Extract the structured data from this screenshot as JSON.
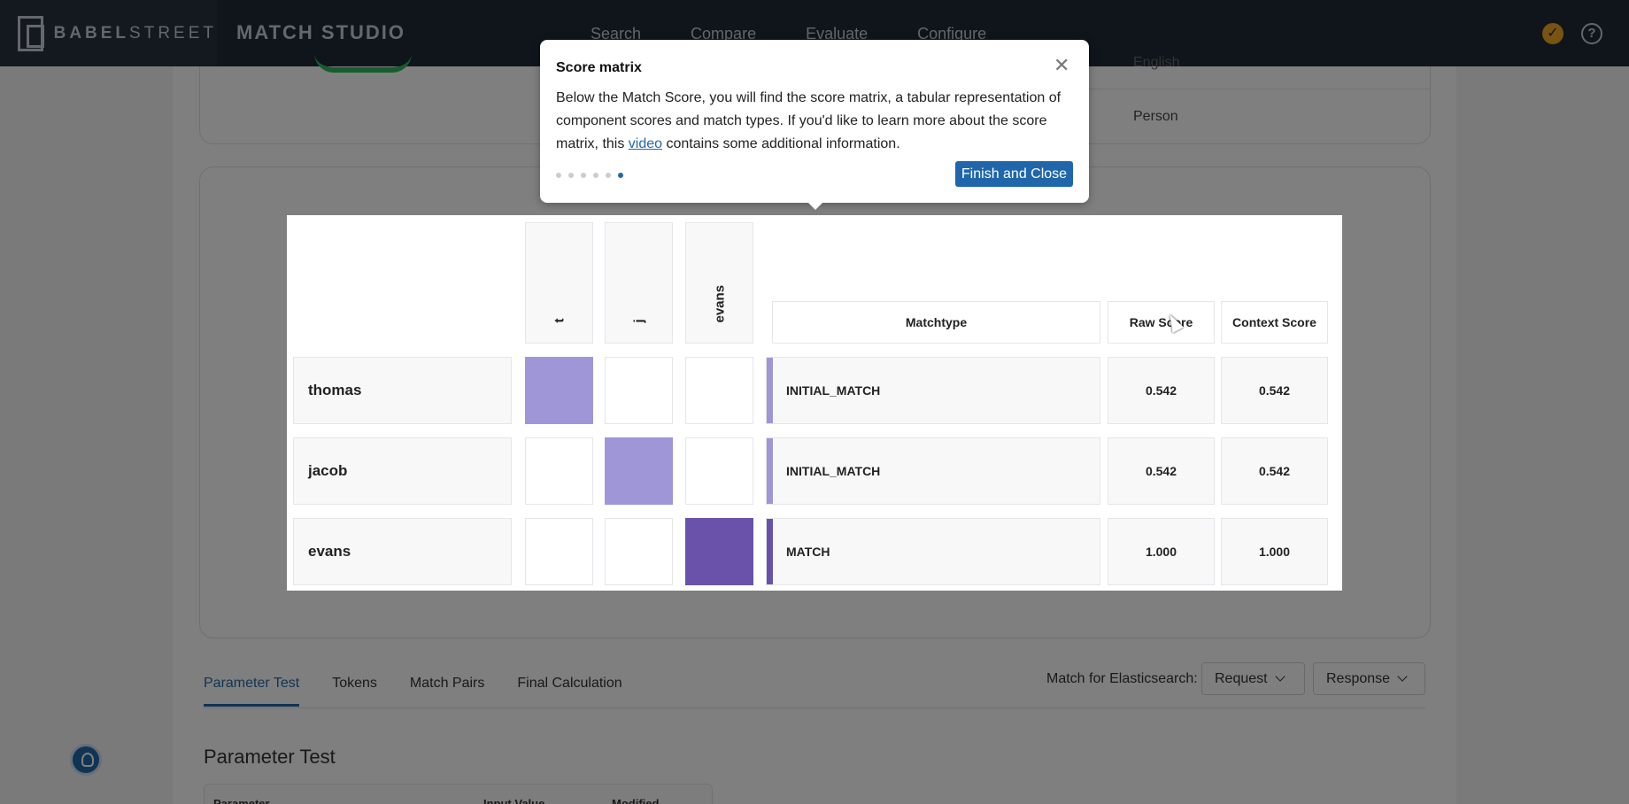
{
  "header": {
    "logo_bold": "BABEL",
    "logo_light": "STREET",
    "app_name": "MATCH STUDIO",
    "nav": [
      "Search",
      "Compare",
      "Evaluate",
      "Configure"
    ],
    "status_icon": "check-circle-icon",
    "help_icon": "question-circle-icon",
    "colors": {
      "bar": "#1f2a37",
      "status": "#f2a623"
    }
  },
  "info_card": {
    "language": "English",
    "entity_type": "Person"
  },
  "popover": {
    "title": "Score matrix",
    "body_before": "Below the Match Score, you will find the score matrix, a tabular representation of component scores and match types. If you'd like to learn more about the score matrix, this ",
    "link_text": "video",
    "body_after": " contains some additional information.",
    "steps_total": 6,
    "step_current": 6,
    "finish_label": "Finish and Close",
    "close_icon": "close-icon"
  },
  "matrix": {
    "columns": [
      "t",
      "j",
      "evans"
    ],
    "headers": {
      "matchtype": "Matchtype",
      "raw": "Raw Score",
      "context": "Context Score"
    },
    "rows": [
      {
        "name": "thomas",
        "matchtype": "INITIAL_MATCH",
        "raw": "0.542",
        "context": "0.542",
        "active_col": 0,
        "color": "#9f96d8"
      },
      {
        "name": "jacob",
        "matchtype": "INITIAL_MATCH",
        "raw": "0.542",
        "context": "0.542",
        "active_col": 1,
        "color": "#9f96d8"
      },
      {
        "name": "evans",
        "matchtype": "MATCH",
        "raw": "1.000",
        "context": "1.000",
        "active_col": 2,
        "color": "#6a52ab"
      }
    ]
  },
  "bottom": {
    "tabs": [
      "Parameter Test",
      "Tokens",
      "Match Pairs",
      "Final Calculation"
    ],
    "active_tab": 0,
    "es_label": "Match for Elasticsearch:",
    "request_label": "Request",
    "response_label": "Response",
    "section_title": "Parameter Test",
    "table_headers": [
      "Parameter",
      "Input Value",
      "Modified"
    ],
    "tip_icon": "lightbulb-icon"
  }
}
